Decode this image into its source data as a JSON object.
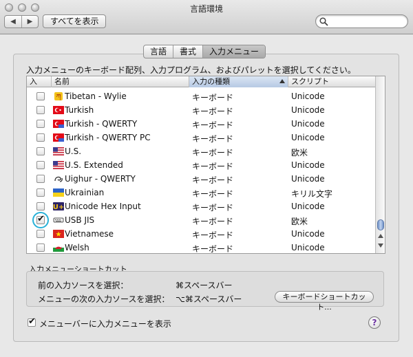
{
  "window": {
    "title": "言語環境"
  },
  "toolbar": {
    "back_icon": "triangle-left",
    "forward_icon": "triangle-right",
    "show_all": "すべてを表示",
    "search_placeholder": "",
    "search_icon": "magnifier"
  },
  "tabs": [
    {
      "label": "言語",
      "active": false
    },
    {
      "label": "書式",
      "active": false
    },
    {
      "label": "入力メニュー",
      "active": true
    }
  ],
  "description": "入力メニューのキーボード配列、入力プログラム、およびパレットを選択してください。",
  "table": {
    "headers": {
      "check": "入",
      "name": "名前",
      "kind": "入力の種類",
      "script": "スクリプト"
    },
    "sort_column": "kind",
    "rows": [
      {
        "checked": false,
        "icon": "tibetan",
        "name": "Tibetan - Wylie",
        "kind": "キーボード",
        "script": "Unicode"
      },
      {
        "checked": false,
        "icon": "turkey-flag",
        "name": "Turkish",
        "kind": "キーボード",
        "script": "Unicode"
      },
      {
        "checked": false,
        "icon": "turkey-flag",
        "name": "Turkish - QWERTY",
        "kind": "キーボード",
        "script": "Unicode"
      },
      {
        "checked": false,
        "icon": "turkey-flag",
        "name": "Turkish - QWERTY PC",
        "kind": "キーボード",
        "script": "Unicode"
      },
      {
        "checked": false,
        "icon": "us-flag",
        "name": "U.S.",
        "kind": "キーボード",
        "script": "欧米"
      },
      {
        "checked": false,
        "icon": "us-flag",
        "name": "U.S. Extended",
        "kind": "キーボード",
        "script": "Unicode"
      },
      {
        "checked": false,
        "icon": "uighur",
        "name": "Uighur - QWERTY",
        "kind": "キーボード",
        "script": "Unicode"
      },
      {
        "checked": false,
        "icon": "ukraine-flag",
        "name": "Ukrainian",
        "kind": "キーボード",
        "script": "キリル文字"
      },
      {
        "checked": false,
        "icon": "unicode-hex",
        "name": "Unicode Hex Input",
        "kind": "キーボード",
        "script": "Unicode"
      },
      {
        "checked": true,
        "icon": "usb-keyboard",
        "name": "USB JIS",
        "kind": "キーボード",
        "script": "欧米"
      },
      {
        "checked": false,
        "icon": "vietnam-flag",
        "name": "Vietnamese",
        "kind": "キーボード",
        "script": "Unicode"
      },
      {
        "checked": false,
        "icon": "wales-flag",
        "name": "Welsh",
        "kind": "キーボード",
        "script": "Unicode"
      }
    ]
  },
  "shortcuts": {
    "section_label": "入力メニューショートカット",
    "prev_label": "前の入力ソースを選択：",
    "prev_value": "⌘スペースバー",
    "next_label": "メニューの次の入力ソースを選択：",
    "next_value": "⌥⌘スペースバー",
    "keyboard_button": "キーボードショートカット..."
  },
  "show_in_menubar": {
    "checked": true,
    "label": "メニューバーに入力メニューを表示"
  },
  "help_label": "?",
  "colors": {
    "highlight_ring": "#27b1d8",
    "selected_header": "#b6c9e4",
    "scroll_thumb": "#6d90c8"
  }
}
